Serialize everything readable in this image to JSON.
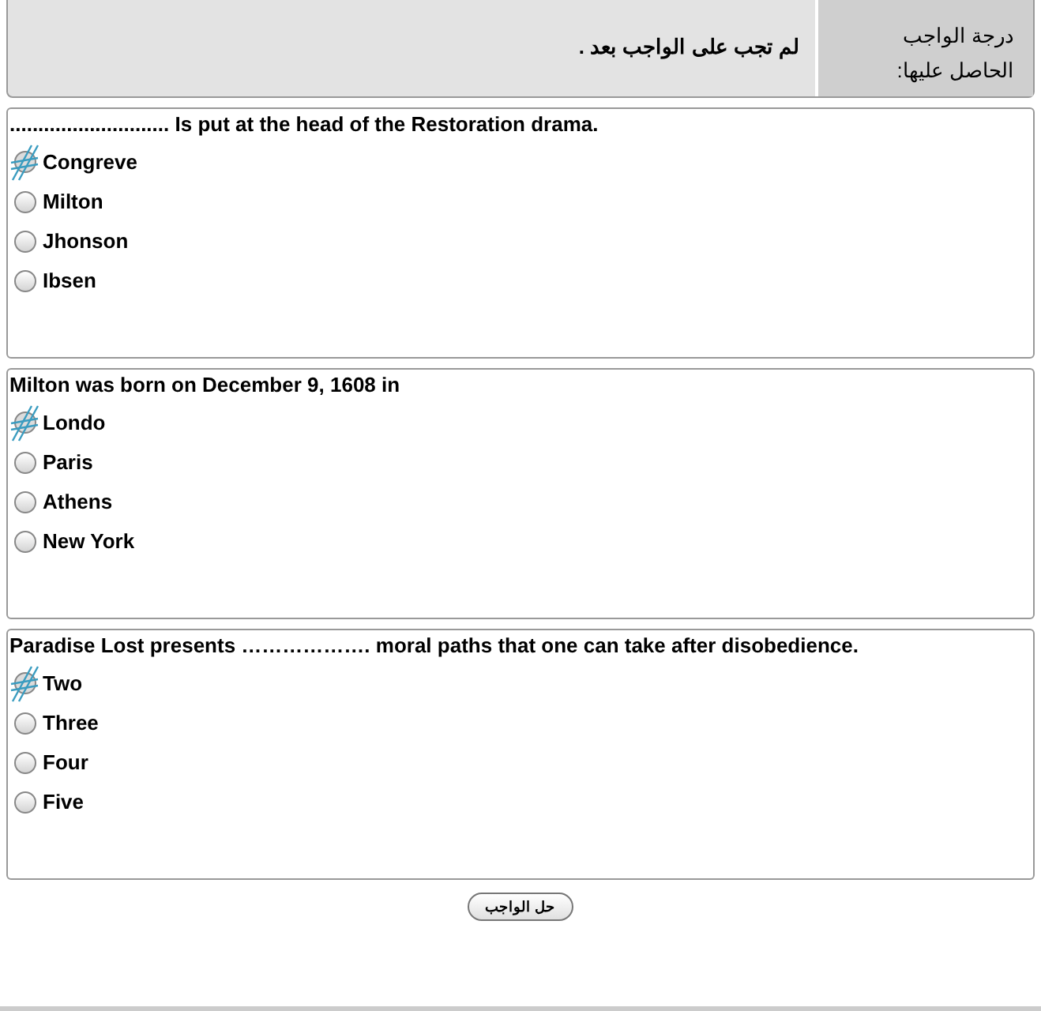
{
  "grade": {
    "label": "درجة الواجب الحاصل عليها:",
    "value": "لم تجب على الواجب بعد ."
  },
  "questions": [
    {
      "text": "............................ Is put at the head of the Restoration drama.",
      "options": [
        {
          "label": "Congreve",
          "selected": true
        },
        {
          "label": "Milton",
          "selected": false
        },
        {
          "label": "Jhonson",
          "selected": false
        },
        {
          "label": "Ibsen",
          "selected": false
        }
      ]
    },
    {
      "text": "Milton was born on December 9, 1608 in",
      "options": [
        {
          "label": "Londo",
          "selected": true
        },
        {
          "label": "Paris",
          "selected": false
        },
        {
          "label": "Athens",
          "selected": false
        },
        {
          "label": "New York",
          "selected": false
        }
      ]
    },
    {
      "text": "Paradise Lost presents ………………. moral paths that one can take after disobedience.",
      "options": [
        {
          "label": "Two",
          "selected": true
        },
        {
          "label": "Three",
          "selected": false
        },
        {
          "label": "Four",
          "selected": false
        },
        {
          "label": "Five",
          "selected": false
        }
      ]
    }
  ],
  "submit_button": "حل الواجب"
}
